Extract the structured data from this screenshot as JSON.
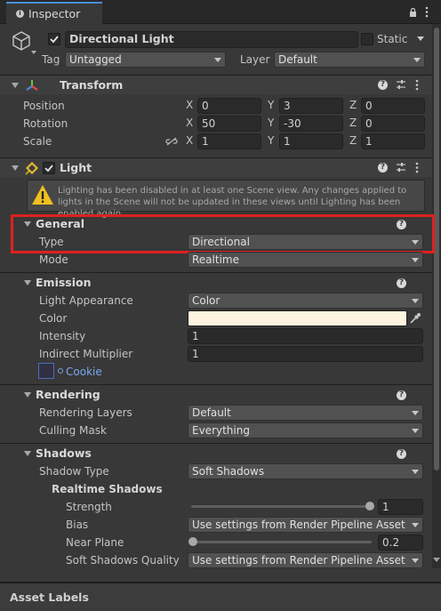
{
  "tab": {
    "title": "Inspector"
  },
  "object": {
    "name": "Directional Light",
    "static_label": "Static",
    "tag_label": "Tag",
    "tag_value": "Untagged",
    "layer_label": "Layer",
    "layer_value": "Default"
  },
  "transform": {
    "title": "Transform",
    "position_label": "Position",
    "rotation_label": "Rotation",
    "scale_label": "Scale",
    "x": "X",
    "y": "Y",
    "z": "Z",
    "position": [
      "0",
      "3",
      "0"
    ],
    "rotation": [
      "50",
      "-30",
      "0"
    ],
    "scale": [
      "1",
      "1",
      "1"
    ]
  },
  "light": {
    "title": "Light",
    "warning": "Lighting has been disabled in at least one Scene view. Any changes applied to lights in the Scene will not be updated in these views until Lighting has been enabled again.",
    "general": {
      "title": "General",
      "type_label": "Type",
      "type_value": "Directional",
      "mode_label": "Mode",
      "mode_value": "Realtime"
    },
    "emission": {
      "title": "Emission",
      "appearance_label": "Light Appearance",
      "appearance_value": "Color",
      "color_label": "Color",
      "color_value": "#fff4e0",
      "intensity_label": "Intensity",
      "intensity_value": "1",
      "indirect_label": "Indirect Multiplier",
      "indirect_value": "1",
      "cookie_label": "Cookie"
    },
    "rendering": {
      "title": "Rendering",
      "layers_label": "Rendering Layers",
      "layers_value": "Default",
      "culling_label": "Culling Mask",
      "culling_value": "Everything"
    },
    "shadows": {
      "title": "Shadows",
      "type_label": "Shadow Type",
      "type_value": "Soft Shadows",
      "realtime_title": "Realtime Shadows",
      "strength_label": "Strength",
      "strength_value": "1",
      "bias_label": "Bias",
      "bias_value": "Use settings from Render Pipeline Asset",
      "near_label": "Near Plane",
      "near_value": "0.2",
      "soft_label": "Soft Shadows Quality",
      "soft_value": "Use settings from Render Pipeline Asset"
    }
  },
  "footer": {
    "asset_labels": "Asset Labels"
  },
  "colors": {
    "highlight": "#e02020",
    "bg": "#383838"
  }
}
